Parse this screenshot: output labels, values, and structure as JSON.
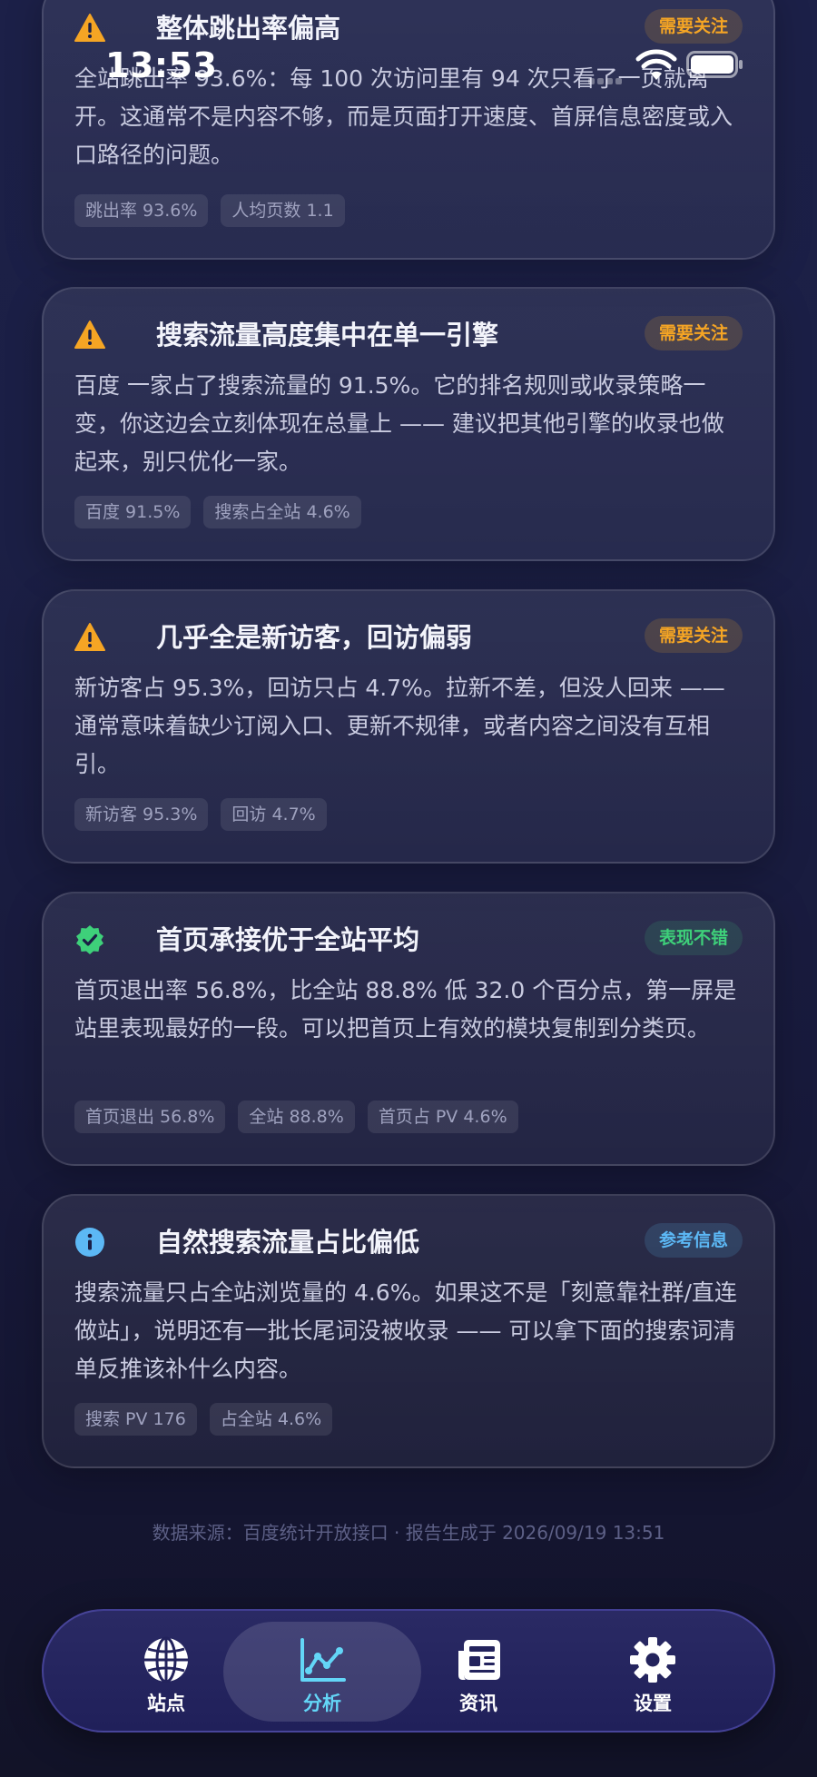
{
  "status_bar": {
    "time": "13:53"
  },
  "colors": {
    "warn": "#f5a524",
    "good": "#3ed07a",
    "info": "#5cb8f5",
    "active_tab": "#63d6f7"
  },
  "cards": [
    {
      "icon": "warning-icon",
      "title": "整体跳出率偏高",
      "badge": "需要关注",
      "body": "全站跳出率 93.6%：每 100 次访问里有 94 次只看了一页就离开。这通常不是内容不够，而是页面打开速度、首屏信息密度或入口路径的问题。",
      "tags": [
        "跳出率 93.6%",
        "人均页数 1.1"
      ]
    },
    {
      "icon": "warning-icon",
      "title": "搜索流量高度集中在单一引擎",
      "badge": "需要关注",
      "body": "百度 一家占了搜索流量的 91.5%。它的排名规则或收录策略一变，你这边会立刻体现在总量上 —— 建议把其他引擎的收录也做起来，别只优化一家。",
      "tags": [
        "百度 91.5%",
        "搜索占全站 4.6%"
      ]
    },
    {
      "icon": "warning-icon",
      "title": "几乎全是新访客，回访偏弱",
      "badge": "需要关注",
      "body": "新访客占 95.3%，回访只占 4.7%。拉新不差，但没人回来 —— 通常意味着缺少订阅入口、更新不规律，或者内容之间没有互相引。",
      "tags": [
        "新访客 95.3%",
        "回访 4.7%"
      ]
    },
    {
      "icon": "check-badge-icon",
      "title": "首页承接优于全站平均",
      "badge": "表现不错",
      "body": "首页退出率 56.8%，比全站 88.8% 低 32.0 个百分点，第一屏是站里表现最好的一段。可以把首页上有效的模块复制到分类页。",
      "tags": [
        "首页退出 56.8%",
        "全站 88.8%",
        "首页占 PV 4.6%"
      ]
    },
    {
      "icon": "info-icon",
      "title": "自然搜索流量占比偏低",
      "badge": "参考信息",
      "body": "搜索流量只占全站浏览量的 4.6%。如果这不是「刻意靠社群/直连做站」，说明还有一批长尾词没被收录 —— 可以拿下面的搜索词清单反推该补什么内容。",
      "tags": [
        "搜索 PV 176",
        "占全站 4.6%"
      ]
    }
  ],
  "footer": "数据来源：百度统计开放接口 · 报告生成于 2026/09/19 13:51",
  "tabs": [
    {
      "label": "站点",
      "icon": "globe-icon"
    },
    {
      "label": "分析",
      "icon": "chart-line-icon"
    },
    {
      "label": "资讯",
      "icon": "newspaper-icon"
    },
    {
      "label": "设置",
      "icon": "gear-icon"
    }
  ]
}
